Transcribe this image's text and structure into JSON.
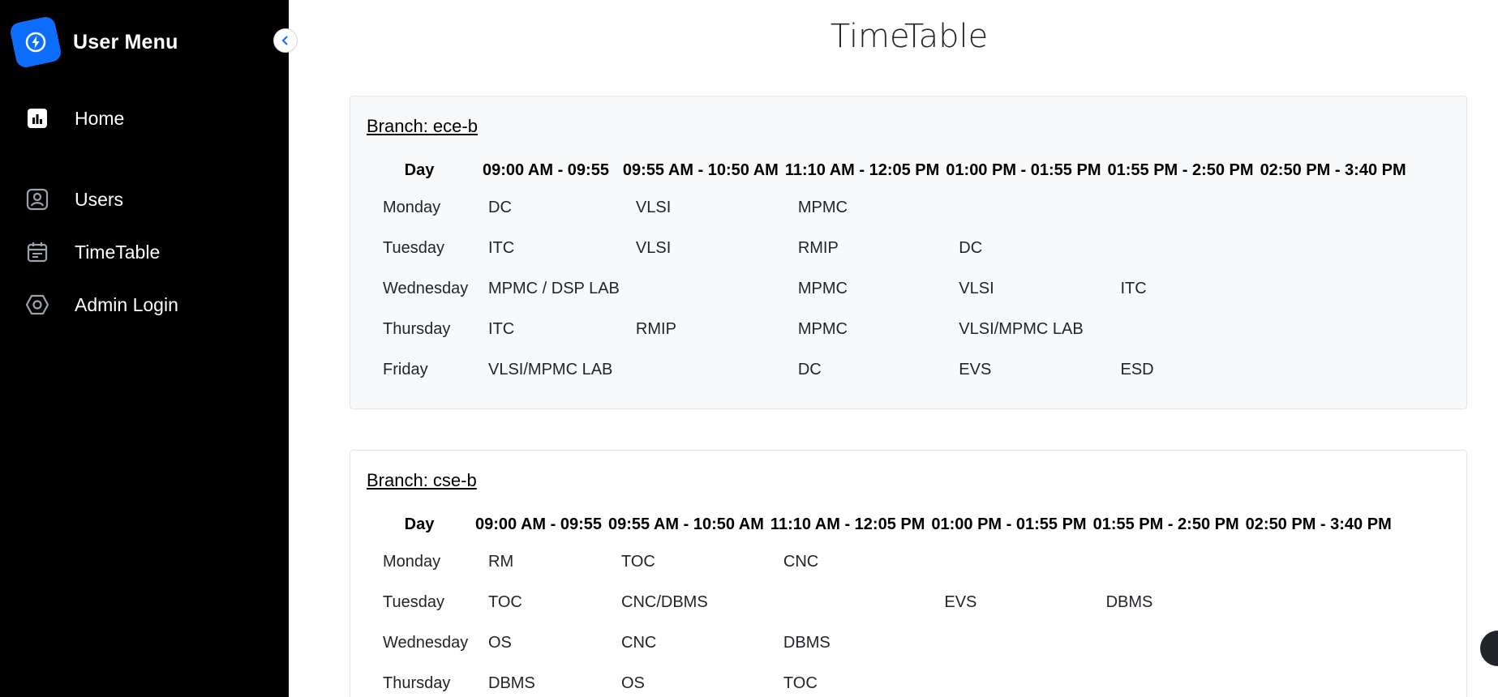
{
  "sidebar": {
    "title": "User Menu",
    "collapse_icon": "chevron-left-icon",
    "items": [
      {
        "label": "Home",
        "icon": "bar-chart-icon"
      },
      {
        "label": "Users",
        "icon": "user-badge-icon"
      },
      {
        "label": "TimeTable",
        "icon": "calendar-icon"
      },
      {
        "label": "Admin Login",
        "icon": "hexagon-icon"
      }
    ]
  },
  "page": {
    "title": "TimeTable"
  },
  "timetable_headers": [
    "Day",
    "09:00 AM - 09:55",
    "09:55 AM - 10:50 AM",
    "11:10 AM - 12:05 PM",
    "01:00 PM - 01:55 PM",
    "01:55 PM - 2:50 PM",
    "02:50 PM - 3:40 PM"
  ],
  "branches": [
    {
      "name": "Branch: ece-b",
      "rows": [
        [
          "Monday",
          "DC",
          "VLSI",
          "MPMC",
          "",
          "",
          ""
        ],
        [
          "Tuesday",
          "ITC",
          "VLSI",
          "RMIP",
          "DC",
          "",
          ""
        ],
        [
          "Wednesday",
          "MPMC / DSP LAB",
          "",
          "MPMC",
          "VLSI",
          "ITC",
          ""
        ],
        [
          "Thursday",
          "ITC",
          "RMIP",
          "MPMC",
          "VLSI/MPMC LAB",
          "",
          ""
        ],
        [
          "Friday",
          "VLSI/MPMC LAB",
          "",
          "DC",
          "EVS",
          "ESD",
          ""
        ]
      ]
    },
    {
      "name": "Branch: cse-b",
      "rows": [
        [
          "Monday",
          "RM",
          "TOC",
          "CNC",
          "",
          "",
          ""
        ],
        [
          "Tuesday",
          "TOC",
          "CNC/DBMS",
          "",
          "EVS",
          "DBMS",
          ""
        ],
        [
          "Wednesday",
          "OS",
          "CNC",
          "DBMS",
          "",
          "",
          ""
        ],
        [
          "Thursday",
          "DBMS",
          "OS",
          "TOC",
          "",
          "",
          ""
        ]
      ]
    }
  ],
  "colors": {
    "sidebar_bg": "#000000",
    "brand_accent": "#0d6efd",
    "card_gray": "#f8f9fa"
  }
}
